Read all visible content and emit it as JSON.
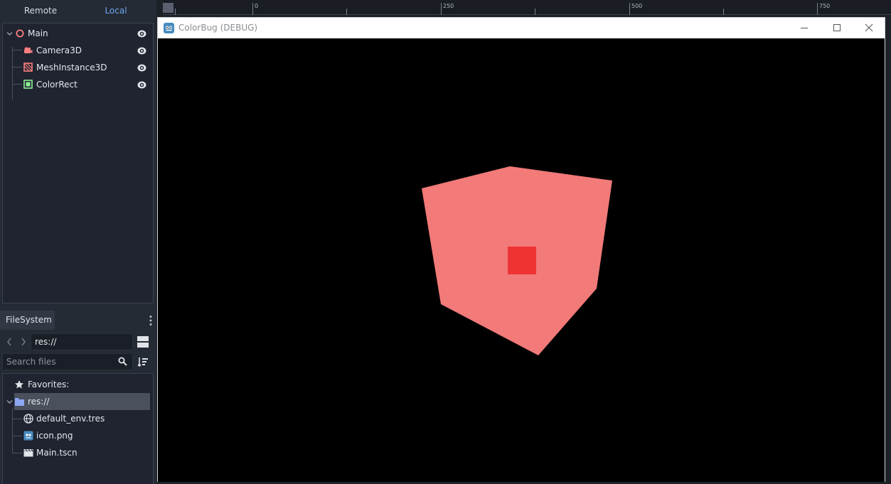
{
  "scene_dock": {
    "tabs": [
      {
        "label": "Remote",
        "active": false
      },
      {
        "label": "Local",
        "active": true
      }
    ],
    "nodes": [
      {
        "label": "Main",
        "icon": "node3d-icon"
      },
      {
        "label": "Camera3D",
        "icon": "camera-icon"
      },
      {
        "label": "MeshInstance3D",
        "icon": "mesh-icon"
      },
      {
        "label": "ColorRect",
        "icon": "colorrect-icon"
      }
    ]
  },
  "filesystem_dock": {
    "tab_label": "FileSystem",
    "path": "res://",
    "search_placeholder": "Search files",
    "favorites_label": "Favorites:",
    "root_label": "res://",
    "files": [
      {
        "label": "default_env.tres",
        "icon": "globe-icon"
      },
      {
        "label": "icon.png",
        "icon": "image-icon"
      },
      {
        "label": "Main.tscn",
        "icon": "clapper-icon"
      }
    ]
  },
  "ruler": {
    "labels": [
      "0",
      "250",
      "500",
      "750"
    ]
  },
  "game_window": {
    "title": "ColorBug (DEBUG)"
  },
  "colors": {
    "cube": "#f27a79",
    "color_rect": "#ed3333",
    "accent": "#6aa7f2"
  }
}
